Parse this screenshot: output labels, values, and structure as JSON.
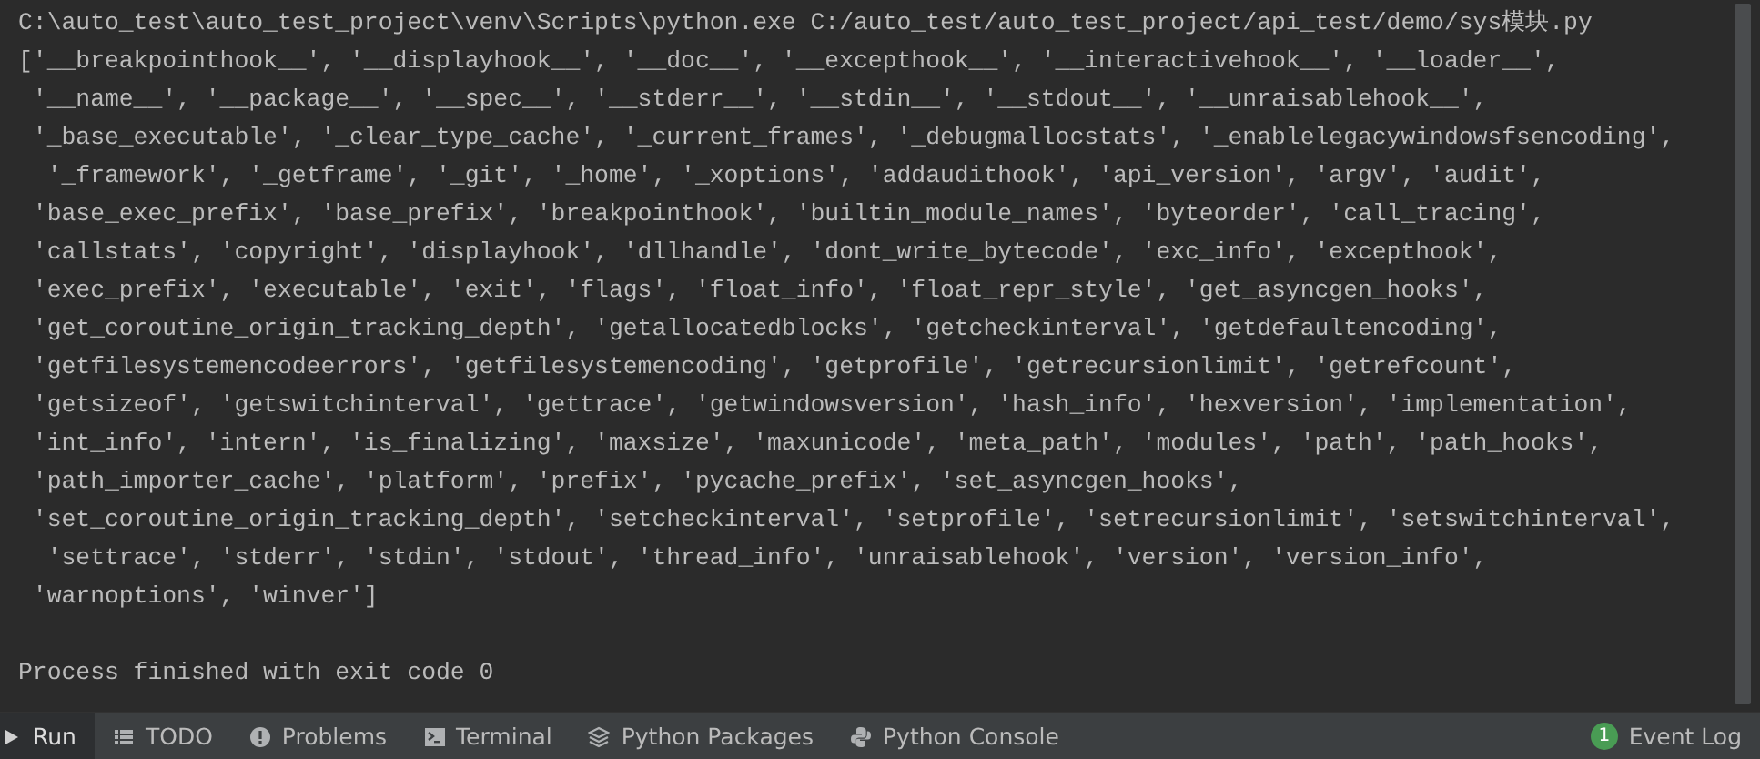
{
  "console": {
    "lines": [
      "C:\\auto_test\\auto_test_project\\venv\\Scripts\\python.exe C:/auto_test/auto_test_project/api_test/demo/sys模块.py",
      "['__breakpointhook__', '__displayhook__', '__doc__', '__excepthook__', '__interactivehook__', '__loader__',",
      " '__name__', '__package__', '__spec__', '__stderr__', '__stdin__', '__stdout__', '__unraisablehook__',",
      " '_base_executable', '_clear_type_cache', '_current_frames', '_debugmallocstats', '_enablelegacywindowsfsencoding',",
      "  '_framework', '_getframe', '_git', '_home', '_xoptions', 'addaudithook', 'api_version', 'argv', 'audit',",
      " 'base_exec_prefix', 'base_prefix', 'breakpointhook', 'builtin_module_names', 'byteorder', 'call_tracing',",
      " 'callstats', 'copyright', 'displayhook', 'dllhandle', 'dont_write_bytecode', 'exc_info', 'excepthook',",
      " 'exec_prefix', 'executable', 'exit', 'flags', 'float_info', 'float_repr_style', 'get_asyncgen_hooks',",
      " 'get_coroutine_origin_tracking_depth', 'getallocatedblocks', 'getcheckinterval', 'getdefaultencoding',",
      " 'getfilesystemencodeerrors', 'getfilesystemencoding', 'getprofile', 'getrecursionlimit', 'getrefcount',",
      " 'getsizeof', 'getswitchinterval', 'gettrace', 'getwindowsversion', 'hash_info', 'hexversion', 'implementation',",
      " 'int_info', 'intern', 'is_finalizing', 'maxsize', 'maxunicode', 'meta_path', 'modules', 'path', 'path_hooks',",
      " 'path_importer_cache', 'platform', 'prefix', 'pycache_prefix', 'set_asyncgen_hooks',",
      " 'set_coroutine_origin_tracking_depth', 'setcheckinterval', 'setprofile', 'setrecursionlimit', 'setswitchinterval',",
      "  'settrace', 'stderr', 'stdin', 'stdout', 'thread_info', 'unraisablehook', 'version', 'version_info',",
      " 'warnoptions', 'winver']"
    ],
    "exit_message": "Process finished with exit code 0"
  },
  "tool_tabs": [
    {
      "kind": "run",
      "label": "Run",
      "selected": true
    },
    {
      "kind": "todo",
      "label": "TODO",
      "selected": false
    },
    {
      "kind": "problems",
      "label": "Problems",
      "selected": false
    },
    {
      "kind": "terminal",
      "label": "Terminal",
      "selected": false
    },
    {
      "kind": "packages",
      "label": "Python Packages",
      "selected": false
    },
    {
      "kind": "console",
      "label": "Python Console",
      "selected": false
    }
  ],
  "event_log": {
    "badge": "1",
    "label": "Event Log"
  }
}
